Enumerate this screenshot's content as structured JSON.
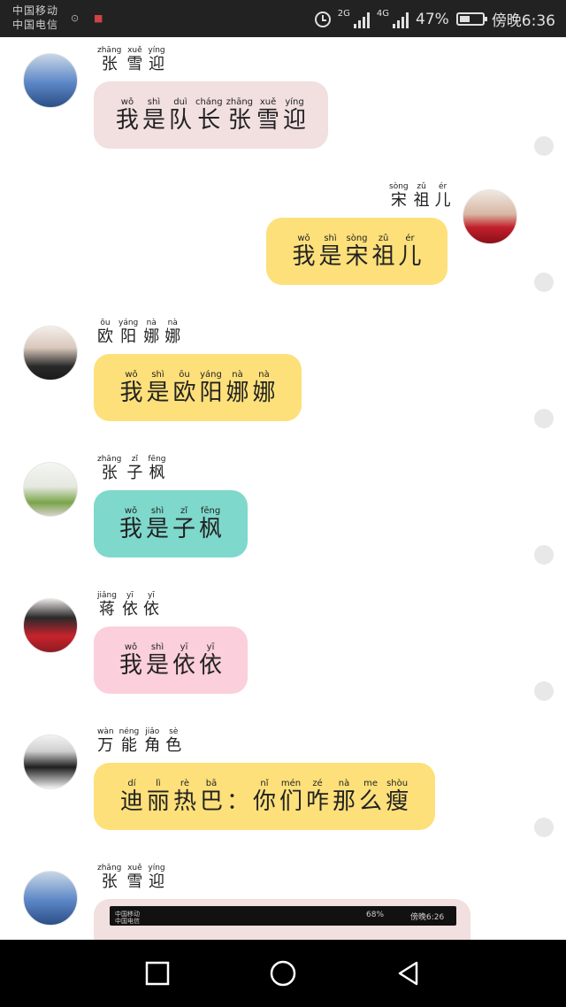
{
  "status_bar": {
    "carrier_1": "中国移动",
    "carrier_2": "中国电信",
    "net_1": "2G",
    "net_2": "4G",
    "battery_percent": "47%",
    "battery_level": 0.47,
    "time": "傍晚6:36"
  },
  "messages": [
    {
      "side": "left",
      "name": [
        [
          "zhāng",
          "张"
        ],
        [
          "xuě",
          "雪"
        ],
        [
          "yíng",
          "迎"
        ]
      ],
      "text": [
        [
          "wǒ",
          "我"
        ],
        [
          "shì",
          "是"
        ],
        [
          "duì",
          "队"
        ],
        [
          "cháng",
          "长"
        ],
        [
          "zhāng",
          "张"
        ],
        [
          "xuě",
          "雪"
        ],
        [
          "yíng",
          "迎"
        ]
      ],
      "bubble_color": "#f2dfe0"
    },
    {
      "side": "right",
      "name": [
        [
          "sòng",
          "宋"
        ],
        [
          "zǔ",
          "祖"
        ],
        [
          "ér",
          "儿"
        ]
      ],
      "text": [
        [
          "wǒ",
          "我"
        ],
        [
          "shì",
          "是"
        ],
        [
          "sòng",
          "宋"
        ],
        [
          "zǔ",
          "祖"
        ],
        [
          "ér",
          "儿"
        ]
      ],
      "bubble_color": "#fde07a"
    },
    {
      "side": "left",
      "name": [
        [
          "ōu",
          "欧"
        ],
        [
          "yáng",
          "阳"
        ],
        [
          "nà",
          "娜"
        ],
        [
          "nà",
          "娜"
        ]
      ],
      "text": [
        [
          "wǒ",
          "我"
        ],
        [
          "shì",
          "是"
        ],
        [
          "ōu",
          "欧"
        ],
        [
          "yáng",
          "阳"
        ],
        [
          "nà",
          "娜"
        ],
        [
          "nà",
          "娜"
        ]
      ],
      "bubble_color": "#fde07a"
    },
    {
      "side": "left",
      "name": [
        [
          "zhāng",
          "张"
        ],
        [
          "zǐ",
          "子"
        ],
        [
          "fēng",
          "枫"
        ]
      ],
      "text": [
        [
          "wǒ",
          "我"
        ],
        [
          "shì",
          "是"
        ],
        [
          "zǐ",
          "子"
        ],
        [
          "fēng",
          "枫"
        ]
      ],
      "bubble_color": "#7fd8cc"
    },
    {
      "side": "left",
      "name": [
        [
          "jiǎng",
          "蒋"
        ],
        [
          "yī",
          "依"
        ],
        [
          "yī",
          "依"
        ]
      ],
      "text": [
        [
          "wǒ",
          "我"
        ],
        [
          "shì",
          "是"
        ],
        [
          "yī",
          "依"
        ],
        [
          "yī",
          "依"
        ]
      ],
      "bubble_color": "#fbcfdb"
    },
    {
      "side": "left",
      "name": [
        [
          "wàn",
          "万"
        ],
        [
          "néng",
          "能"
        ],
        [
          "jiǎo",
          "角"
        ],
        [
          "sè",
          "色"
        ]
      ],
      "text": [
        [
          "dí",
          "迪"
        ],
        [
          "lì",
          "丽"
        ],
        [
          "rè",
          "热"
        ],
        [
          "bā",
          "巴"
        ],
        [
          "",
          "："
        ],
        [
          "nǐ",
          "你"
        ],
        [
          "mén",
          "们"
        ],
        [
          "zé",
          "咋"
        ],
        [
          "nà",
          "那"
        ],
        [
          "me",
          "么"
        ],
        [
          "shòu",
          "瘦"
        ]
      ],
      "bubble_color": "#fde07a"
    },
    {
      "side": "left",
      "name": [
        [
          "zhāng",
          "张"
        ],
        [
          "xuě",
          "雪"
        ],
        [
          "yíng",
          "迎"
        ]
      ],
      "text": [],
      "bubble_color": "#f2dfe0",
      "embedded_status": {
        "carrier_1": "中国移动",
        "carrier_2": "中国电信",
        "battery": "68%",
        "time": "傍晚6:26"
      }
    }
  ],
  "nav": {
    "recent_label": "recent-apps",
    "home_label": "home",
    "back_label": "back"
  }
}
